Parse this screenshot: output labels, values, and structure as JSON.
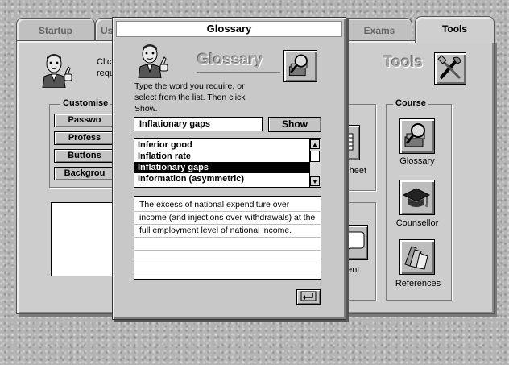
{
  "tabs": [
    {
      "label": "Startup"
    },
    {
      "label": "Us"
    },
    {
      "label": "Exams"
    },
    {
      "label": "Tools"
    }
  ],
  "tools_header": "Tools",
  "intro_partial": {
    "line1": "Click",
    "line2": "requ"
  },
  "customise": {
    "title": "Customise",
    "buttons": [
      "Passwo",
      "Profess",
      "Buttons",
      "Backgrou"
    ]
  },
  "course": {
    "title": "Course",
    "items": [
      {
        "label": "Glossary",
        "icon": "glossary-icon"
      },
      {
        "label": "Counsellor",
        "icon": "mortarboard-icon"
      },
      {
        "label": "References",
        "icon": "books-icon"
      }
    ]
  },
  "middle_partial": {
    "spreadsheet": "dsheet",
    "comment": "ment"
  },
  "dialog": {
    "title": "Glossary",
    "header": "Glossary",
    "instructions": "Type the word you require, or select from the list. Then click Show.",
    "search_value": "Inflationary gaps",
    "show_label": "Show",
    "list": [
      {
        "text": "Inferior good",
        "selected": false
      },
      {
        "text": "Inflation rate",
        "selected": false
      },
      {
        "text": "Inflationary gaps",
        "selected": true
      },
      {
        "text": "Information (asymmetric)",
        "selected": false
      }
    ],
    "definition": "The excess of national expenditure over income (and injections over withdrawals) at the full employment level of national income.",
    "return_icon": "return-arrow-icon"
  },
  "colors": {
    "selection": "#000000",
    "panel": "#cdcdcd",
    "desktop": "#b4b4b4"
  }
}
